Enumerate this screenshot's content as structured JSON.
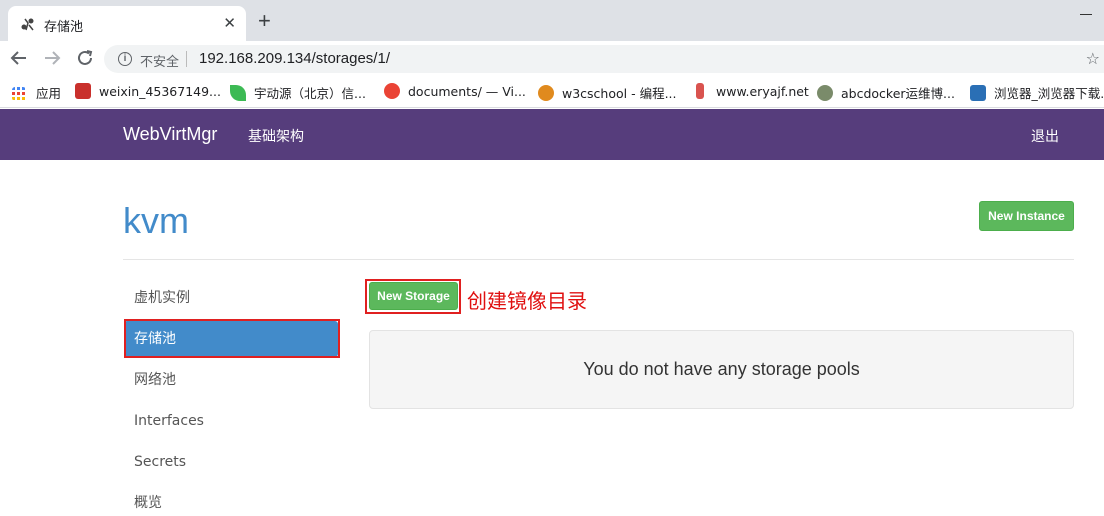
{
  "browser": {
    "tab_title": "存储池",
    "tab_close": "✕",
    "new_tab": "+",
    "security_label": "不安全",
    "url": "192.168.209.134/storages/1/",
    "bookmarks": [
      {
        "label": "应用",
        "color": "#4285f4"
      },
      {
        "label": "weixin_45367149...",
        "color": "#c9302c"
      },
      {
        "label": "宇动源（北京）信...",
        "color": "#3cba54"
      },
      {
        "label": "documents/ — Vi...",
        "color": "#ea4335"
      },
      {
        "label": "w3cschool - 编程...",
        "color": "#e08a1e"
      },
      {
        "label": "www.eryajf.net",
        "color": "#d9534f"
      },
      {
        "label": "abcdocker运维博...",
        "color": "#7a8b6a"
      },
      {
        "label": "浏览器_浏览器下载...",
        "color": "#2a6fb5"
      }
    ]
  },
  "navbar": {
    "brand": "WebVirtMgr",
    "infrastructure": "基础架构",
    "logout": "退出"
  },
  "page": {
    "title": "kvm",
    "new_instance_label": "New Instance",
    "new_storage_label": "New Storage",
    "annotation": "创建镜像目录",
    "empty_message": "You do not have any storage pools"
  },
  "sidebar": {
    "items": [
      {
        "label": "虚机实例"
      },
      {
        "label": "存储池"
      },
      {
        "label": "网络池"
      },
      {
        "label": "Interfaces"
      },
      {
        "label": "Secrets"
      },
      {
        "label": "概览"
      }
    ]
  },
  "colors": {
    "navbar": "#563d7c",
    "accent": "#428bca",
    "button_green": "#5cb85c",
    "annotation_red": "#e02020"
  }
}
